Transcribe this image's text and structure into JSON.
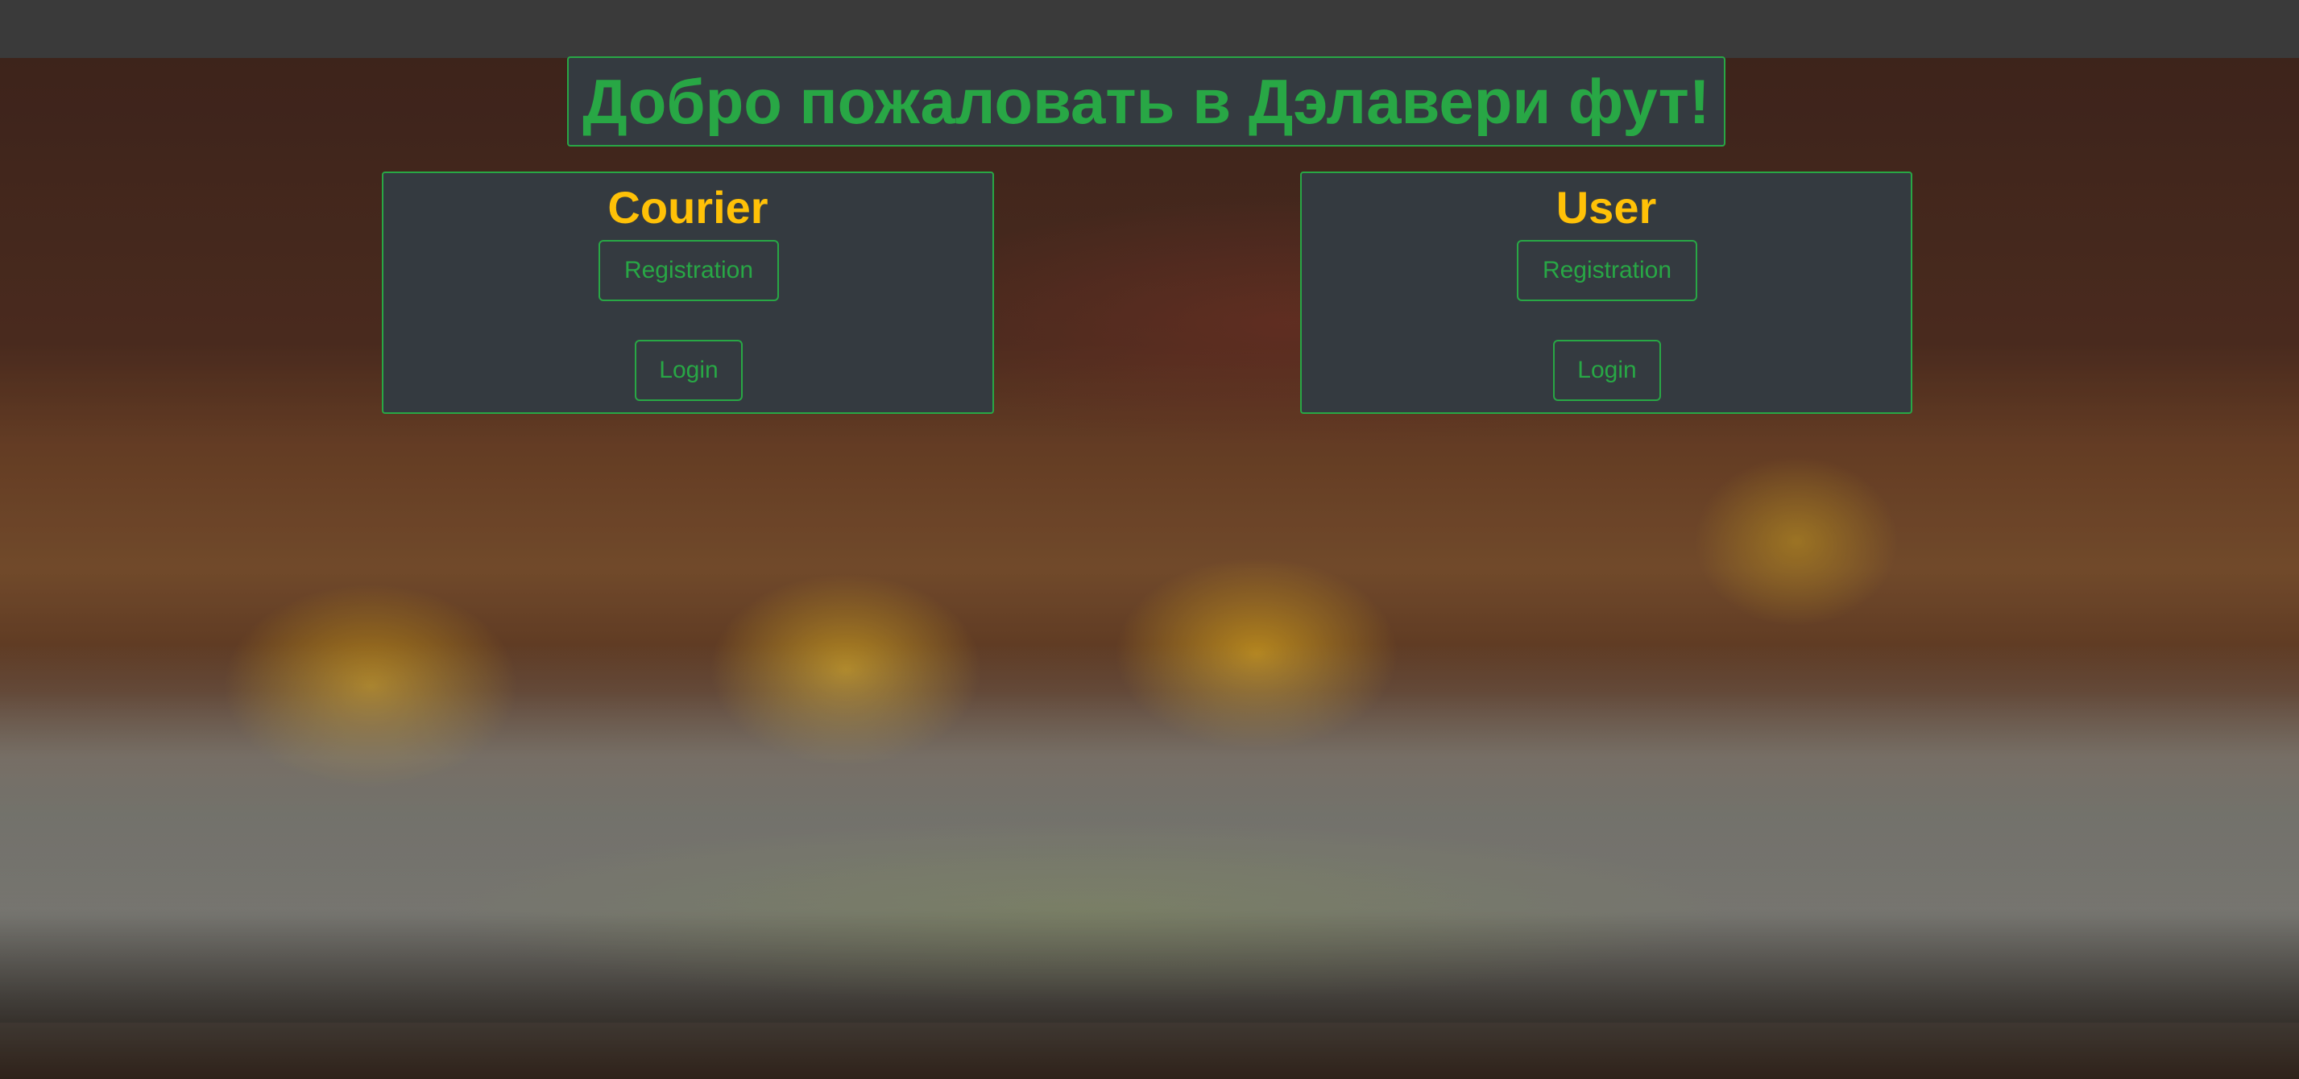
{
  "header": {
    "title": "Добро пожаловать в Дэлавери фут!"
  },
  "panels": {
    "courier": {
      "title": "Courier",
      "registration_label": "Registration",
      "login_label": "Login"
    },
    "user": {
      "title": "User",
      "registration_label": "Registration",
      "login_label": "Login"
    }
  },
  "colors": {
    "accent_green": "#28a745",
    "title_yellow": "#ffc107",
    "panel_bg": "#343a40",
    "topbar_bg": "#3a3a3a"
  }
}
